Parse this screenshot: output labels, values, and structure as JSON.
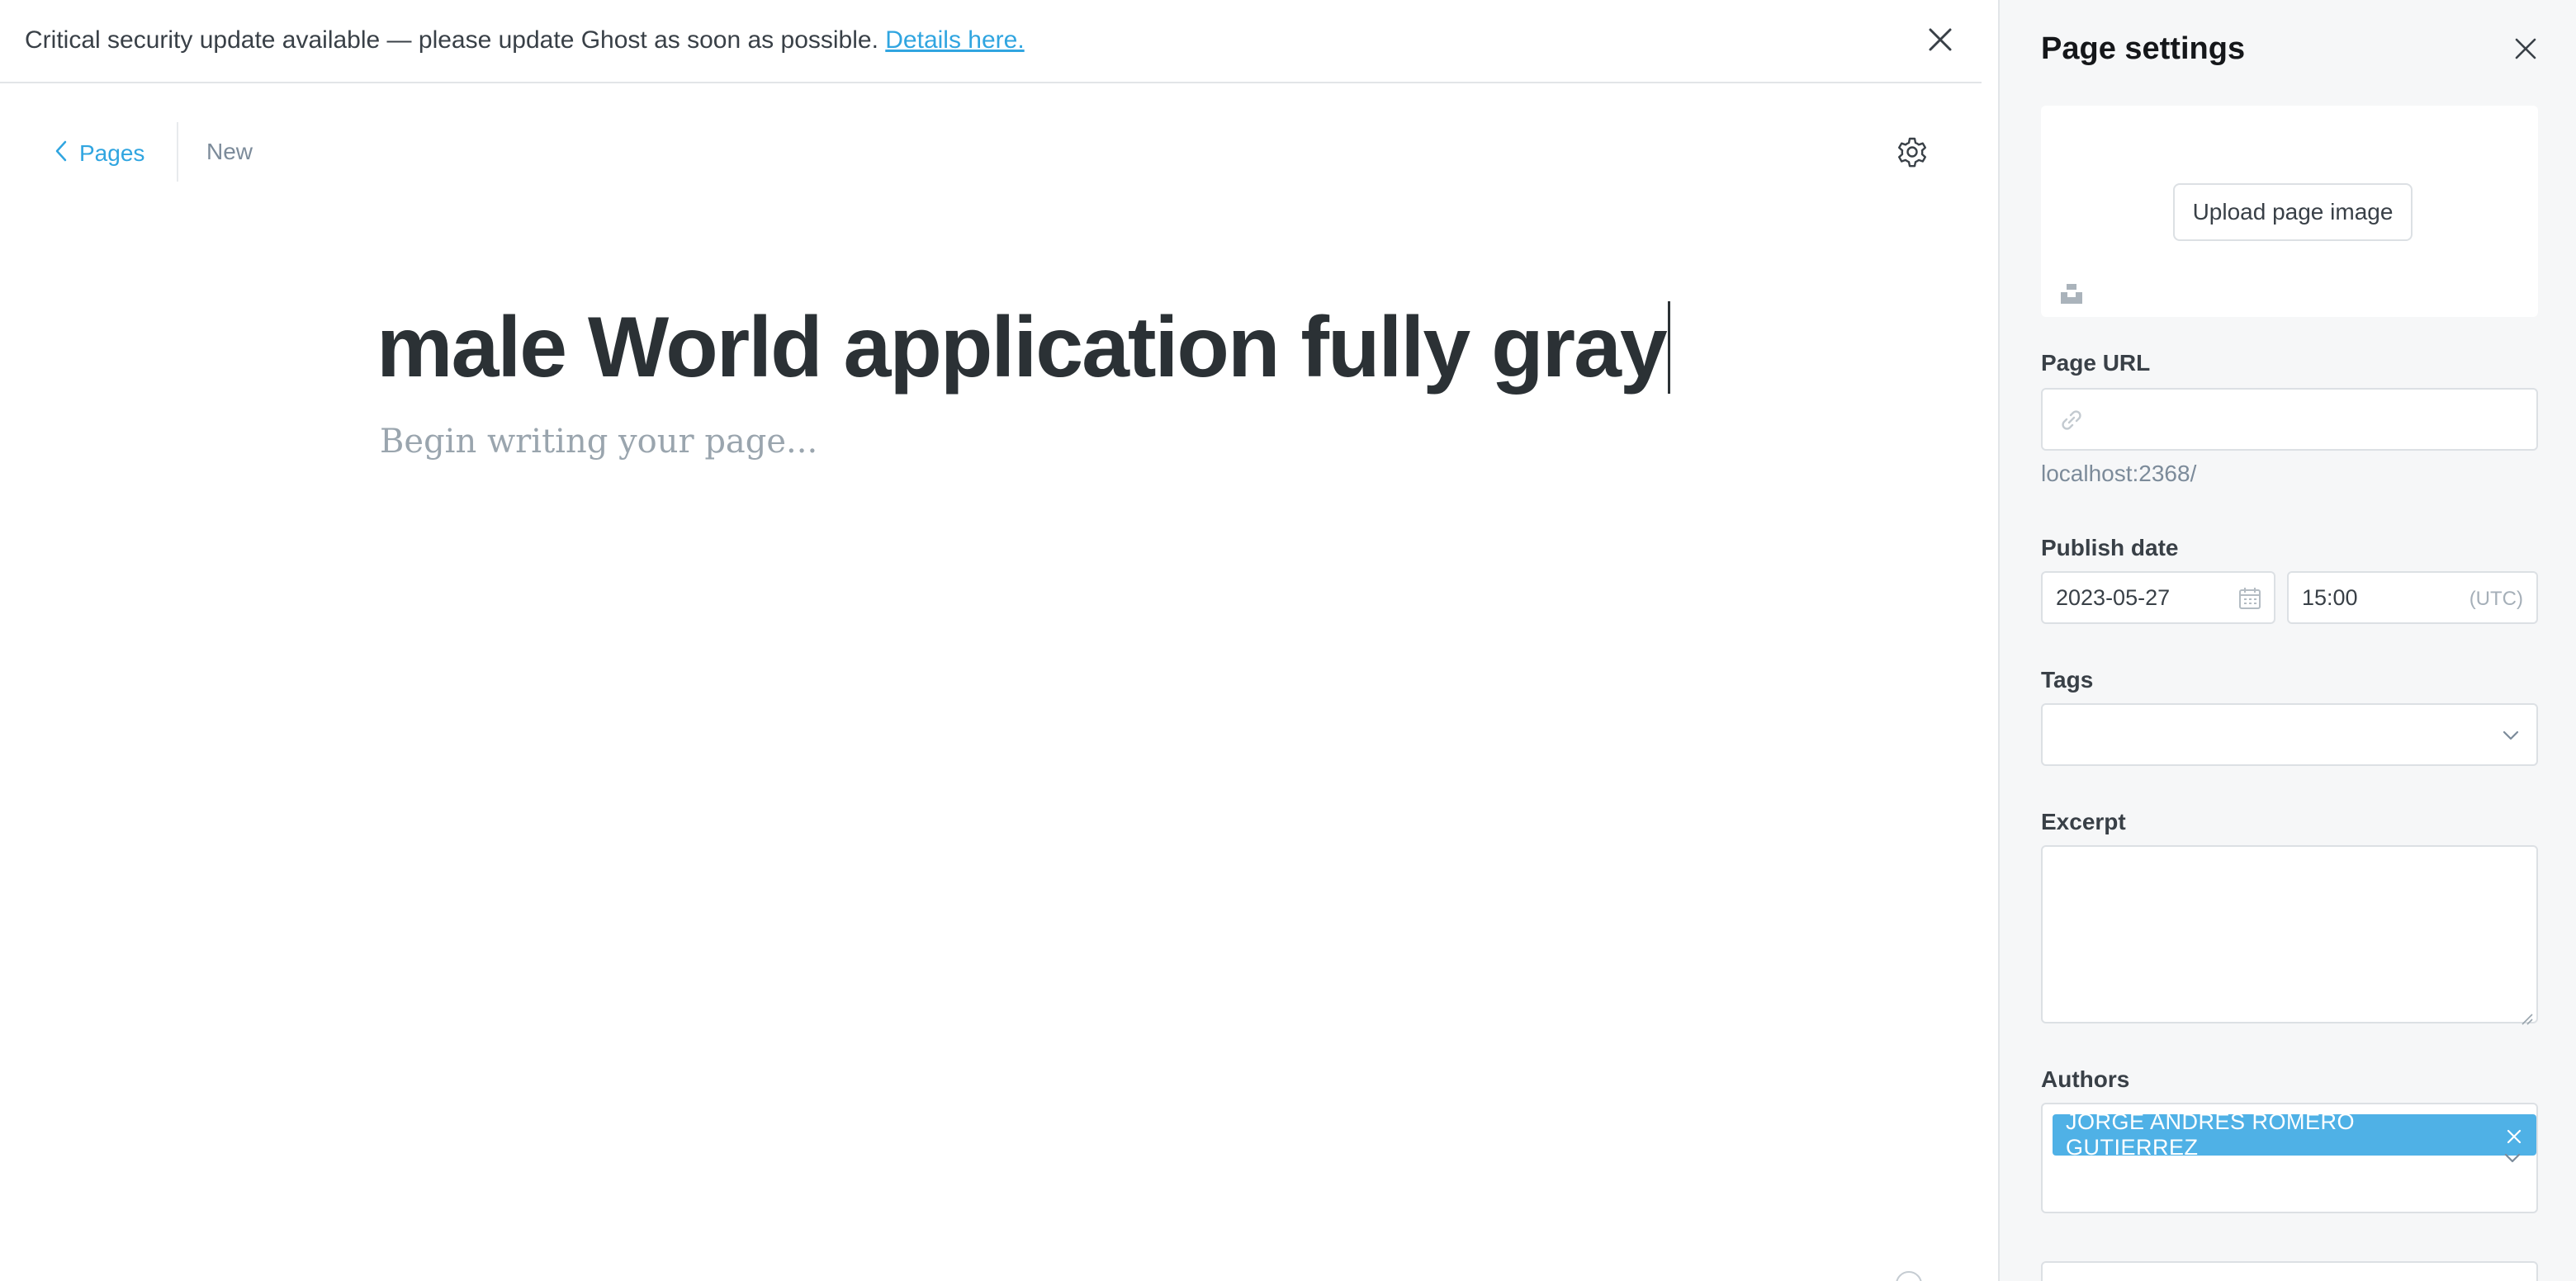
{
  "banner": {
    "message": "Critical security update available — please update Ghost as soon as possible.",
    "link_text": "Details here.",
    "close_icon": "close-icon"
  },
  "nav": {
    "back_label": "Pages",
    "status": "New",
    "back_icon": "chevron-left-icon",
    "settings_icon": "gear-icon"
  },
  "editor": {
    "title": "male World application fully gray",
    "body_placeholder": "Begin writing your page..."
  },
  "settings": {
    "heading": "Page settings",
    "upload_label": "Upload page image",
    "page_url_label": "Page URL",
    "page_url_value": "",
    "page_url_hint": "localhost:2368/",
    "publish_date_label": "Publish date",
    "date_value": "2023-05-27",
    "time_value": "15:00",
    "timezone": "(UTC)",
    "tags_label": "Tags",
    "excerpt_label": "Excerpt",
    "excerpt_value": "",
    "authors_label": "Authors",
    "authors": [
      "JORGE ANDRES ROMERO GUTIERREZ"
    ]
  },
  "colors": {
    "accent": "#30a5e0",
    "token": "#4fb1e6",
    "panel_bg": "#f6f7f8"
  }
}
